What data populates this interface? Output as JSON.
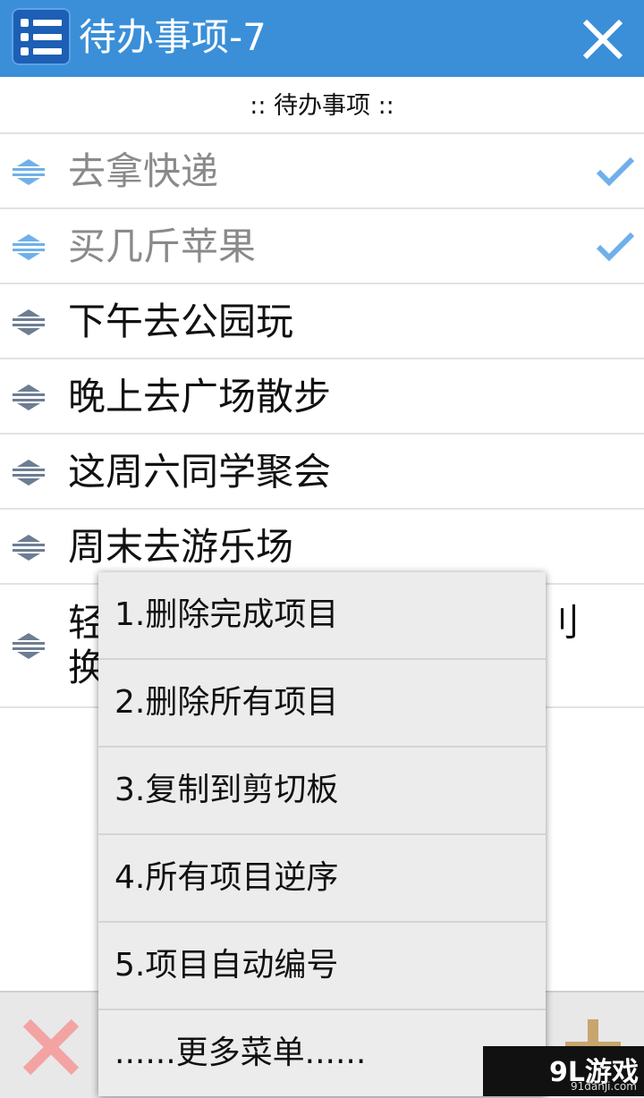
{
  "app": {
    "title": "待办事项-7"
  },
  "list": {
    "header": ":: 待办事项 ::",
    "items": [
      {
        "text": "去拿快递",
        "done": true
      },
      {
        "text": "买几斤苹果",
        "done": true
      },
      {
        "text": "下午去公园玩",
        "done": false
      },
      {
        "text": "晚上去广场散步",
        "done": false
      },
      {
        "text": "这周六同学聚会",
        "done": false
      },
      {
        "text": "周末去游乐场",
        "done": false
      },
      {
        "text": "轻",
        "text_right": "刂",
        "text_line2": "换",
        "done": false
      }
    ]
  },
  "menu": {
    "items": [
      "1.删除完成项目",
      "2.删除所有项目",
      "3.复制到剪切板",
      "4.所有项目逆序",
      "5.项目自动编号",
      "......更多菜单......"
    ]
  },
  "watermark": {
    "main": "9L游戏",
    "sub": "91danji.com"
  },
  "colors": {
    "titlebar": "#3a8fd8",
    "check": "#6fb0ea",
    "delete": "#f4a3a3",
    "add": "#c8a56e"
  },
  "icons": {
    "app": "list-icon",
    "close": "close-icon",
    "handle": "drag-handle-icon",
    "check": "check-icon",
    "delete": "x-icon",
    "add": "plus-icon"
  }
}
